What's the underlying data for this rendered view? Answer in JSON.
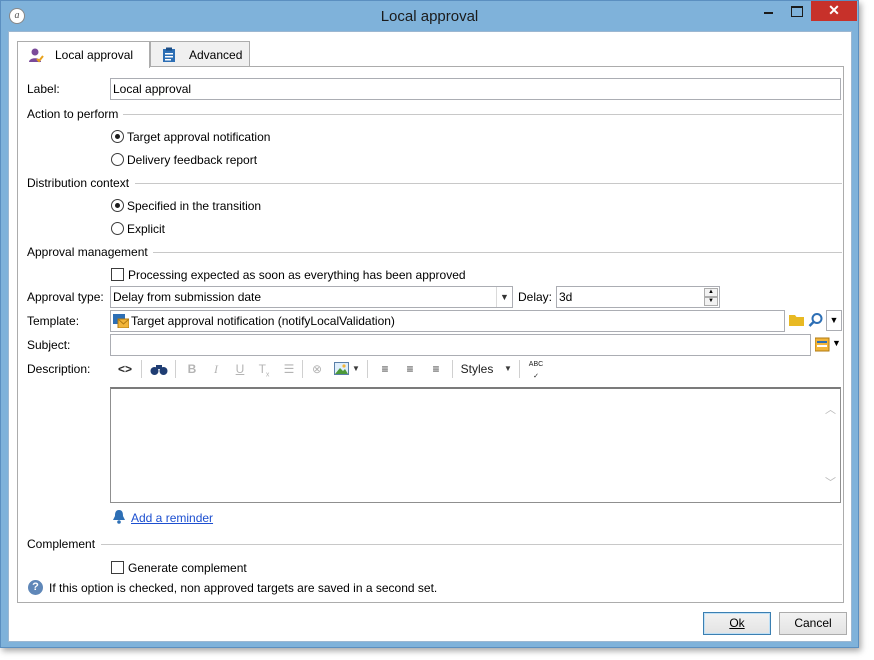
{
  "window": {
    "title": "Local approval",
    "close_glyph": "✕"
  },
  "tabs": [
    {
      "label": "Local approval",
      "icon": "user-approval-icon",
      "active": true
    },
    {
      "label": "Advanced",
      "icon": "clipboard-icon",
      "active": false
    }
  ],
  "form": {
    "label_caption": "Label:",
    "label_value": "Local approval",
    "action_section": "Action to perform",
    "action_options": [
      {
        "label": "Target approval notification",
        "selected": true
      },
      {
        "label": "Delivery feedback report",
        "selected": false
      }
    ],
    "context_section": "Distribution context",
    "context_options": [
      {
        "label": "Specified in the transition",
        "selected": true
      },
      {
        "label": "Explicit",
        "selected": false
      }
    ],
    "approval_section": "Approval management",
    "processing_checkbox": {
      "label": "Processing expected as soon as everything has been approved",
      "checked": false
    },
    "approval_type_caption": "Approval type:",
    "approval_type_value": "Delay from submission date",
    "delay_caption": "Delay:",
    "delay_value": "3d",
    "template_caption": "Template:",
    "template_value": "Target approval notification (notifyLocalValidation)",
    "subject_caption": "Subject:",
    "subject_value": "",
    "description_caption": "Description:",
    "toolbar": {
      "bold": "B",
      "italic": "I",
      "underline": "U",
      "styles": "Styles",
      "spell": "ABC"
    },
    "add_reminder": "Add a reminder",
    "complement_section": "Complement",
    "complement_checkbox": {
      "label": "Generate complement",
      "checked": false
    },
    "help_text": "If this option is checked, non approved targets are saved in a second set."
  },
  "buttons": {
    "ok": "Ok",
    "cancel": "Cancel"
  },
  "colors": {
    "window_frame": "#7fb2da",
    "close_button": "#c7312a",
    "link": "#1c4fd0",
    "folder_icon": "#e8b923"
  }
}
